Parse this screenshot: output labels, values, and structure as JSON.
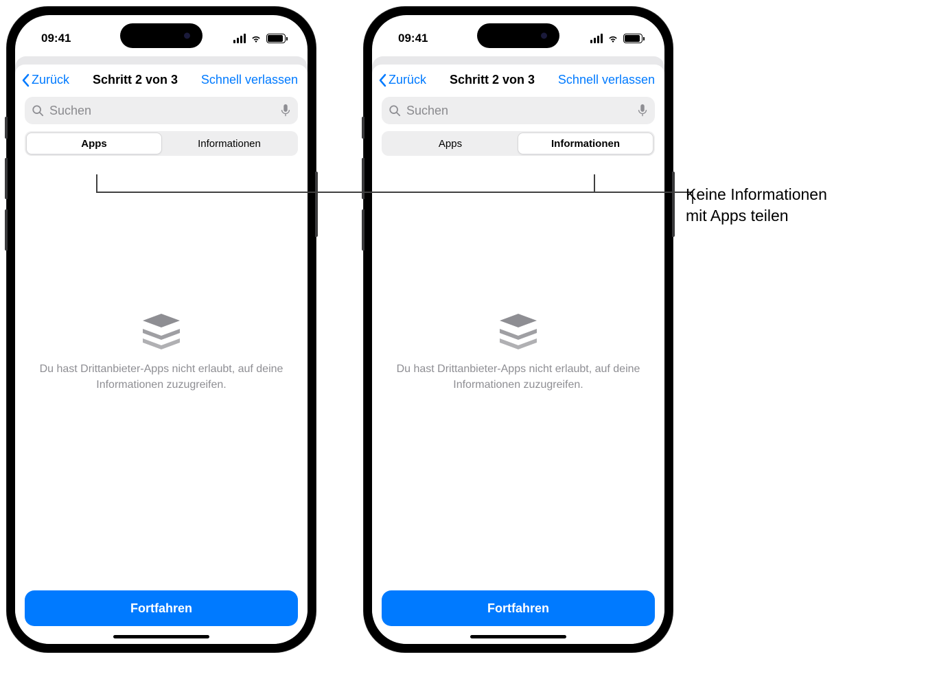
{
  "status": {
    "time": "09:41"
  },
  "nav": {
    "back": "Zurück",
    "title": "Schritt 2 von 3",
    "exit": "Schnell verlassen"
  },
  "search": {
    "placeholder": "Suchen"
  },
  "segment": {
    "apps": "Apps",
    "info": "Informationen"
  },
  "empty": {
    "text": "Du hast Drittanbieter-Apps nicht erlaubt, auf deine Informationen zuzugreifen."
  },
  "button": {
    "continue": "Fortfahren"
  },
  "callout": {
    "line1": "Keine Informationen",
    "line2": "mit Apps teilen"
  }
}
